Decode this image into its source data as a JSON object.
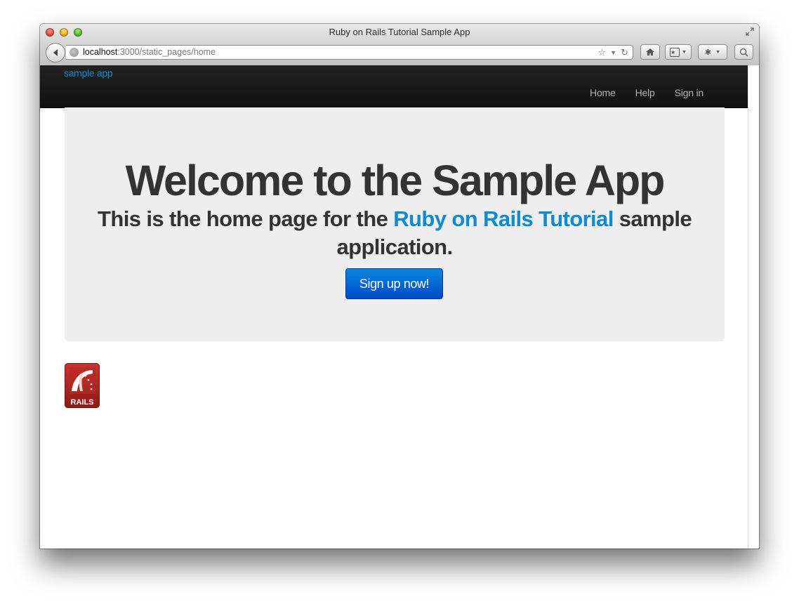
{
  "window": {
    "title": "Ruby on Rails Tutorial Sample App"
  },
  "browser": {
    "url_host": "localhost",
    "url_path": ":3000/static_pages/home"
  },
  "navbar": {
    "brand": "sample app",
    "links": [
      {
        "label": "Home"
      },
      {
        "label": "Help"
      },
      {
        "label": "Sign in"
      }
    ]
  },
  "hero": {
    "heading": "Welcome to the Sample App",
    "subtitle_before": "This is the home page for the ",
    "subtitle_link": "Ruby on Rails Tutorial",
    "subtitle_after": " sample application.",
    "signup_button": "Sign up now!"
  },
  "footer_logo": {
    "text": "RAILS"
  },
  "colors": {
    "link_blue": "#0f8bd0",
    "navbar_bg": "#1b1b1b",
    "hero_bg": "#eeeeee",
    "button_blue": "#0062cc"
  }
}
